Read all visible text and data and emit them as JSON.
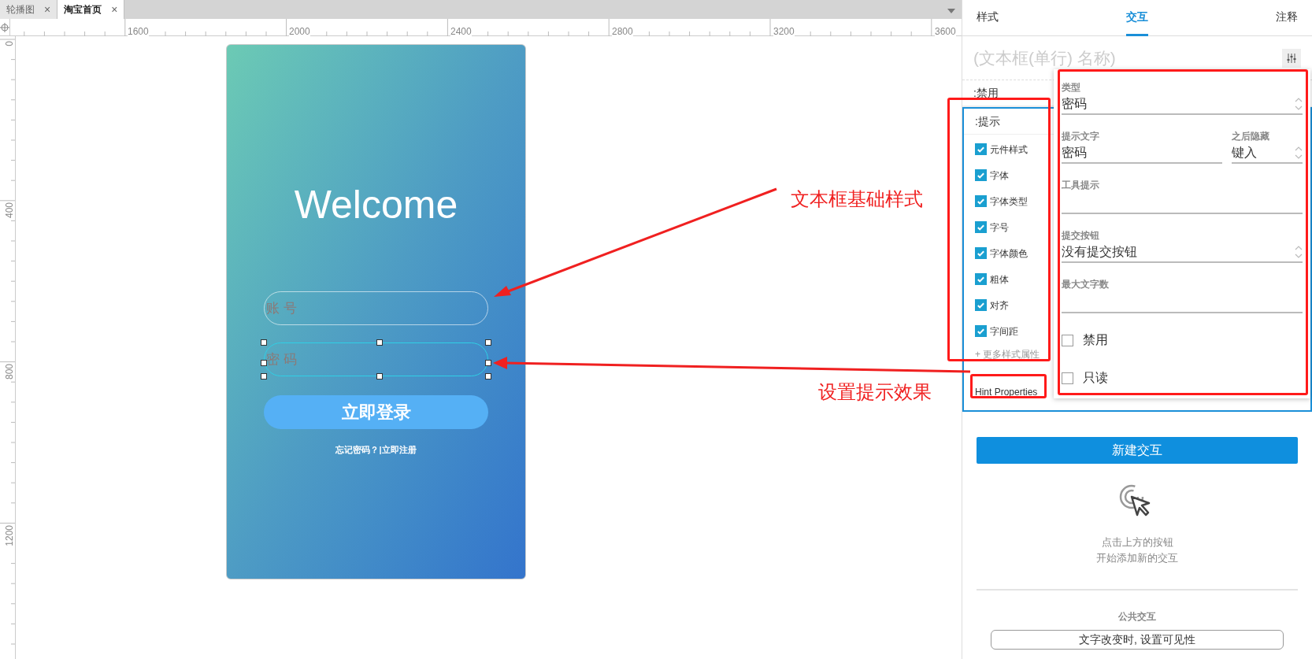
{
  "doc_tabs": [
    {
      "label": "轮播图",
      "close": "×",
      "selected": false
    },
    {
      "label": "淘宝首页",
      "close": "×",
      "selected": true
    }
  ],
  "ruler": {
    "x_labels": [
      "1600",
      "2000",
      "2400",
      "2800",
      "3200",
      "3600"
    ],
    "y_labels": [
      "0",
      "400",
      "800",
      "1200"
    ]
  },
  "phone": {
    "title": "Welcome",
    "fields": [
      {
        "placeholder": "账 号",
        "selected": false
      },
      {
        "placeholder": "密 码",
        "selected": true
      }
    ],
    "login_button": "立即登录",
    "links": "忘记密码？|立即注册"
  },
  "annotations": [
    "文本框基础样式",
    "设置提示效果"
  ],
  "panel": {
    "tabs": [
      {
        "label": "样式",
        "selected": false
      },
      {
        "label": "交互",
        "selected": true
      },
      {
        "label": "注释",
        "selected": false
      }
    ],
    "name_placeholder": "(文本框(单行) 名称)",
    "states": [
      {
        "label": ":禁用",
        "selected": false
      },
      {
        "label": ":提示",
        "selected": true
      }
    ],
    "style_options": [
      {
        "label": "元件样式",
        "checked": true
      },
      {
        "label": "字体",
        "checked": true
      },
      {
        "label": "字体类型",
        "checked": true
      },
      {
        "label": "字号",
        "checked": true
      },
      {
        "label": "字体颜色",
        "checked": true
      },
      {
        "label": "粗体",
        "checked": true
      },
      {
        "label": "对齐",
        "checked": true
      },
      {
        "label": "字间距",
        "checked": true
      }
    ],
    "more_styles": "+ 更多样式属性",
    "hint_link": "Hint Properties",
    "hint_popup": {
      "type_label": "类型",
      "type_value": "密码",
      "hint_text_label": "提示文字",
      "hint_text_value": "密码",
      "hide_label": "之后隐藏",
      "hide_value": "键入",
      "tooltip_label": "工具提示",
      "submit_label": "提交按钮",
      "submit_value": "没有提交按钮",
      "max_label": "最大文字数",
      "checkboxes": [
        {
          "label": "禁用",
          "checked": false
        },
        {
          "label": "只读",
          "checked": false
        }
      ]
    },
    "new_button": "新建交互",
    "empty_hint": [
      "点击上方的按钮",
      "开始添加新的交互"
    ],
    "common_title": "公共交互",
    "common_item": "文字改变时, 设置可见性"
  }
}
